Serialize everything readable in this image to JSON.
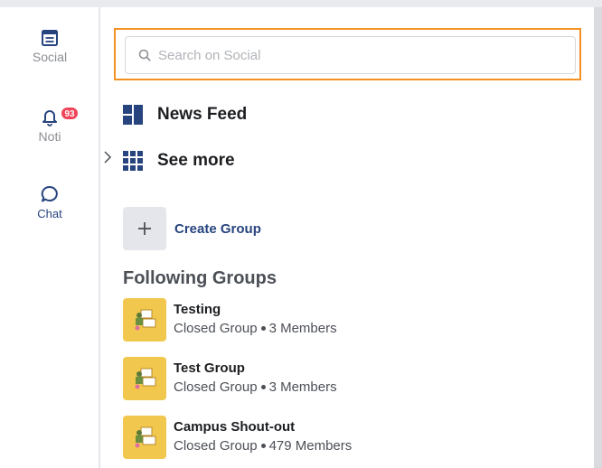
{
  "rail": {
    "items": [
      {
        "label": "Social",
        "icon": "newspaper-icon"
      },
      {
        "label": "Noti",
        "icon": "bell-icon",
        "badge": "93"
      },
      {
        "label": "Chat",
        "icon": "chat-bubble-icon"
      }
    ]
  },
  "search": {
    "placeholder": "Search on Social",
    "value": ""
  },
  "nav": {
    "news_feed": "News Feed",
    "see_more": "See more"
  },
  "create_group": {
    "label": "Create Group"
  },
  "following": {
    "title": "Following Groups",
    "groups": [
      {
        "name": "Testing",
        "privacy": "Closed Group",
        "members": "3 Members"
      },
      {
        "name": "Test Group",
        "privacy": "Closed Group",
        "members": "3 Members"
      },
      {
        "name": "Campus Shout-out",
        "privacy": "Closed Group",
        "members": "479 Members"
      }
    ]
  },
  "colors": {
    "accent": "#27447f",
    "search_focus": "#f39222",
    "badge": "#ef4358",
    "group_thumb": "#f1c84d"
  }
}
